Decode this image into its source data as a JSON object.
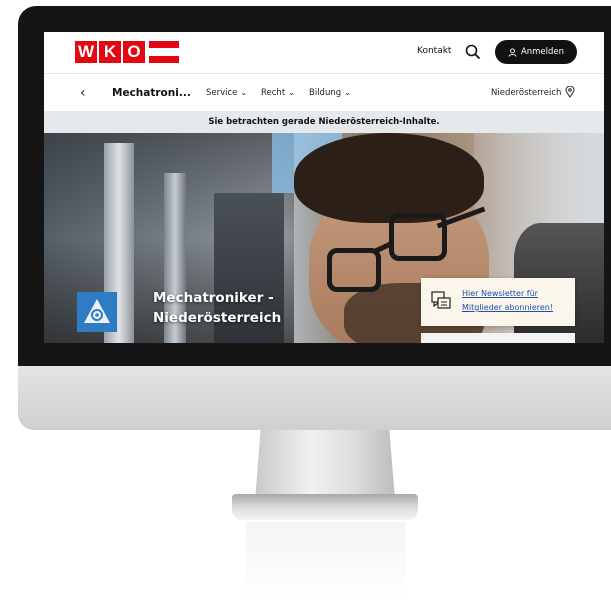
{
  "header": {
    "logo_letters": [
      "W",
      "K",
      "O"
    ],
    "contact_label": "Kontakt",
    "search_icon": "search-icon",
    "login_label": "Anmelden",
    "login_icon": "user-icon"
  },
  "nav": {
    "back_icon": "chevron-left-icon",
    "breadcrumb": "Mechatroni...",
    "menu": [
      {
        "label": "Service"
      },
      {
        "label": "Recht"
      },
      {
        "label": "Bildung"
      }
    ],
    "region": "Niederösterreich",
    "region_icon": "location-pin-icon"
  },
  "notice": "Sie betrachten gerade Niederösterreich-Inhalte.",
  "hero": {
    "title": "Mechatroniker - Niederösterreich",
    "emblem_icon": "guild-emblem-icon",
    "newsletter": {
      "icon": "newsletter-icon",
      "text": "Hier Newsletter für Mitglieder abonnieren!"
    }
  },
  "colors": {
    "brand_red": "#e30613",
    "button_dark": "#111111",
    "emblem_blue": "#2e7cc4",
    "link_blue": "#1f4fa8"
  }
}
